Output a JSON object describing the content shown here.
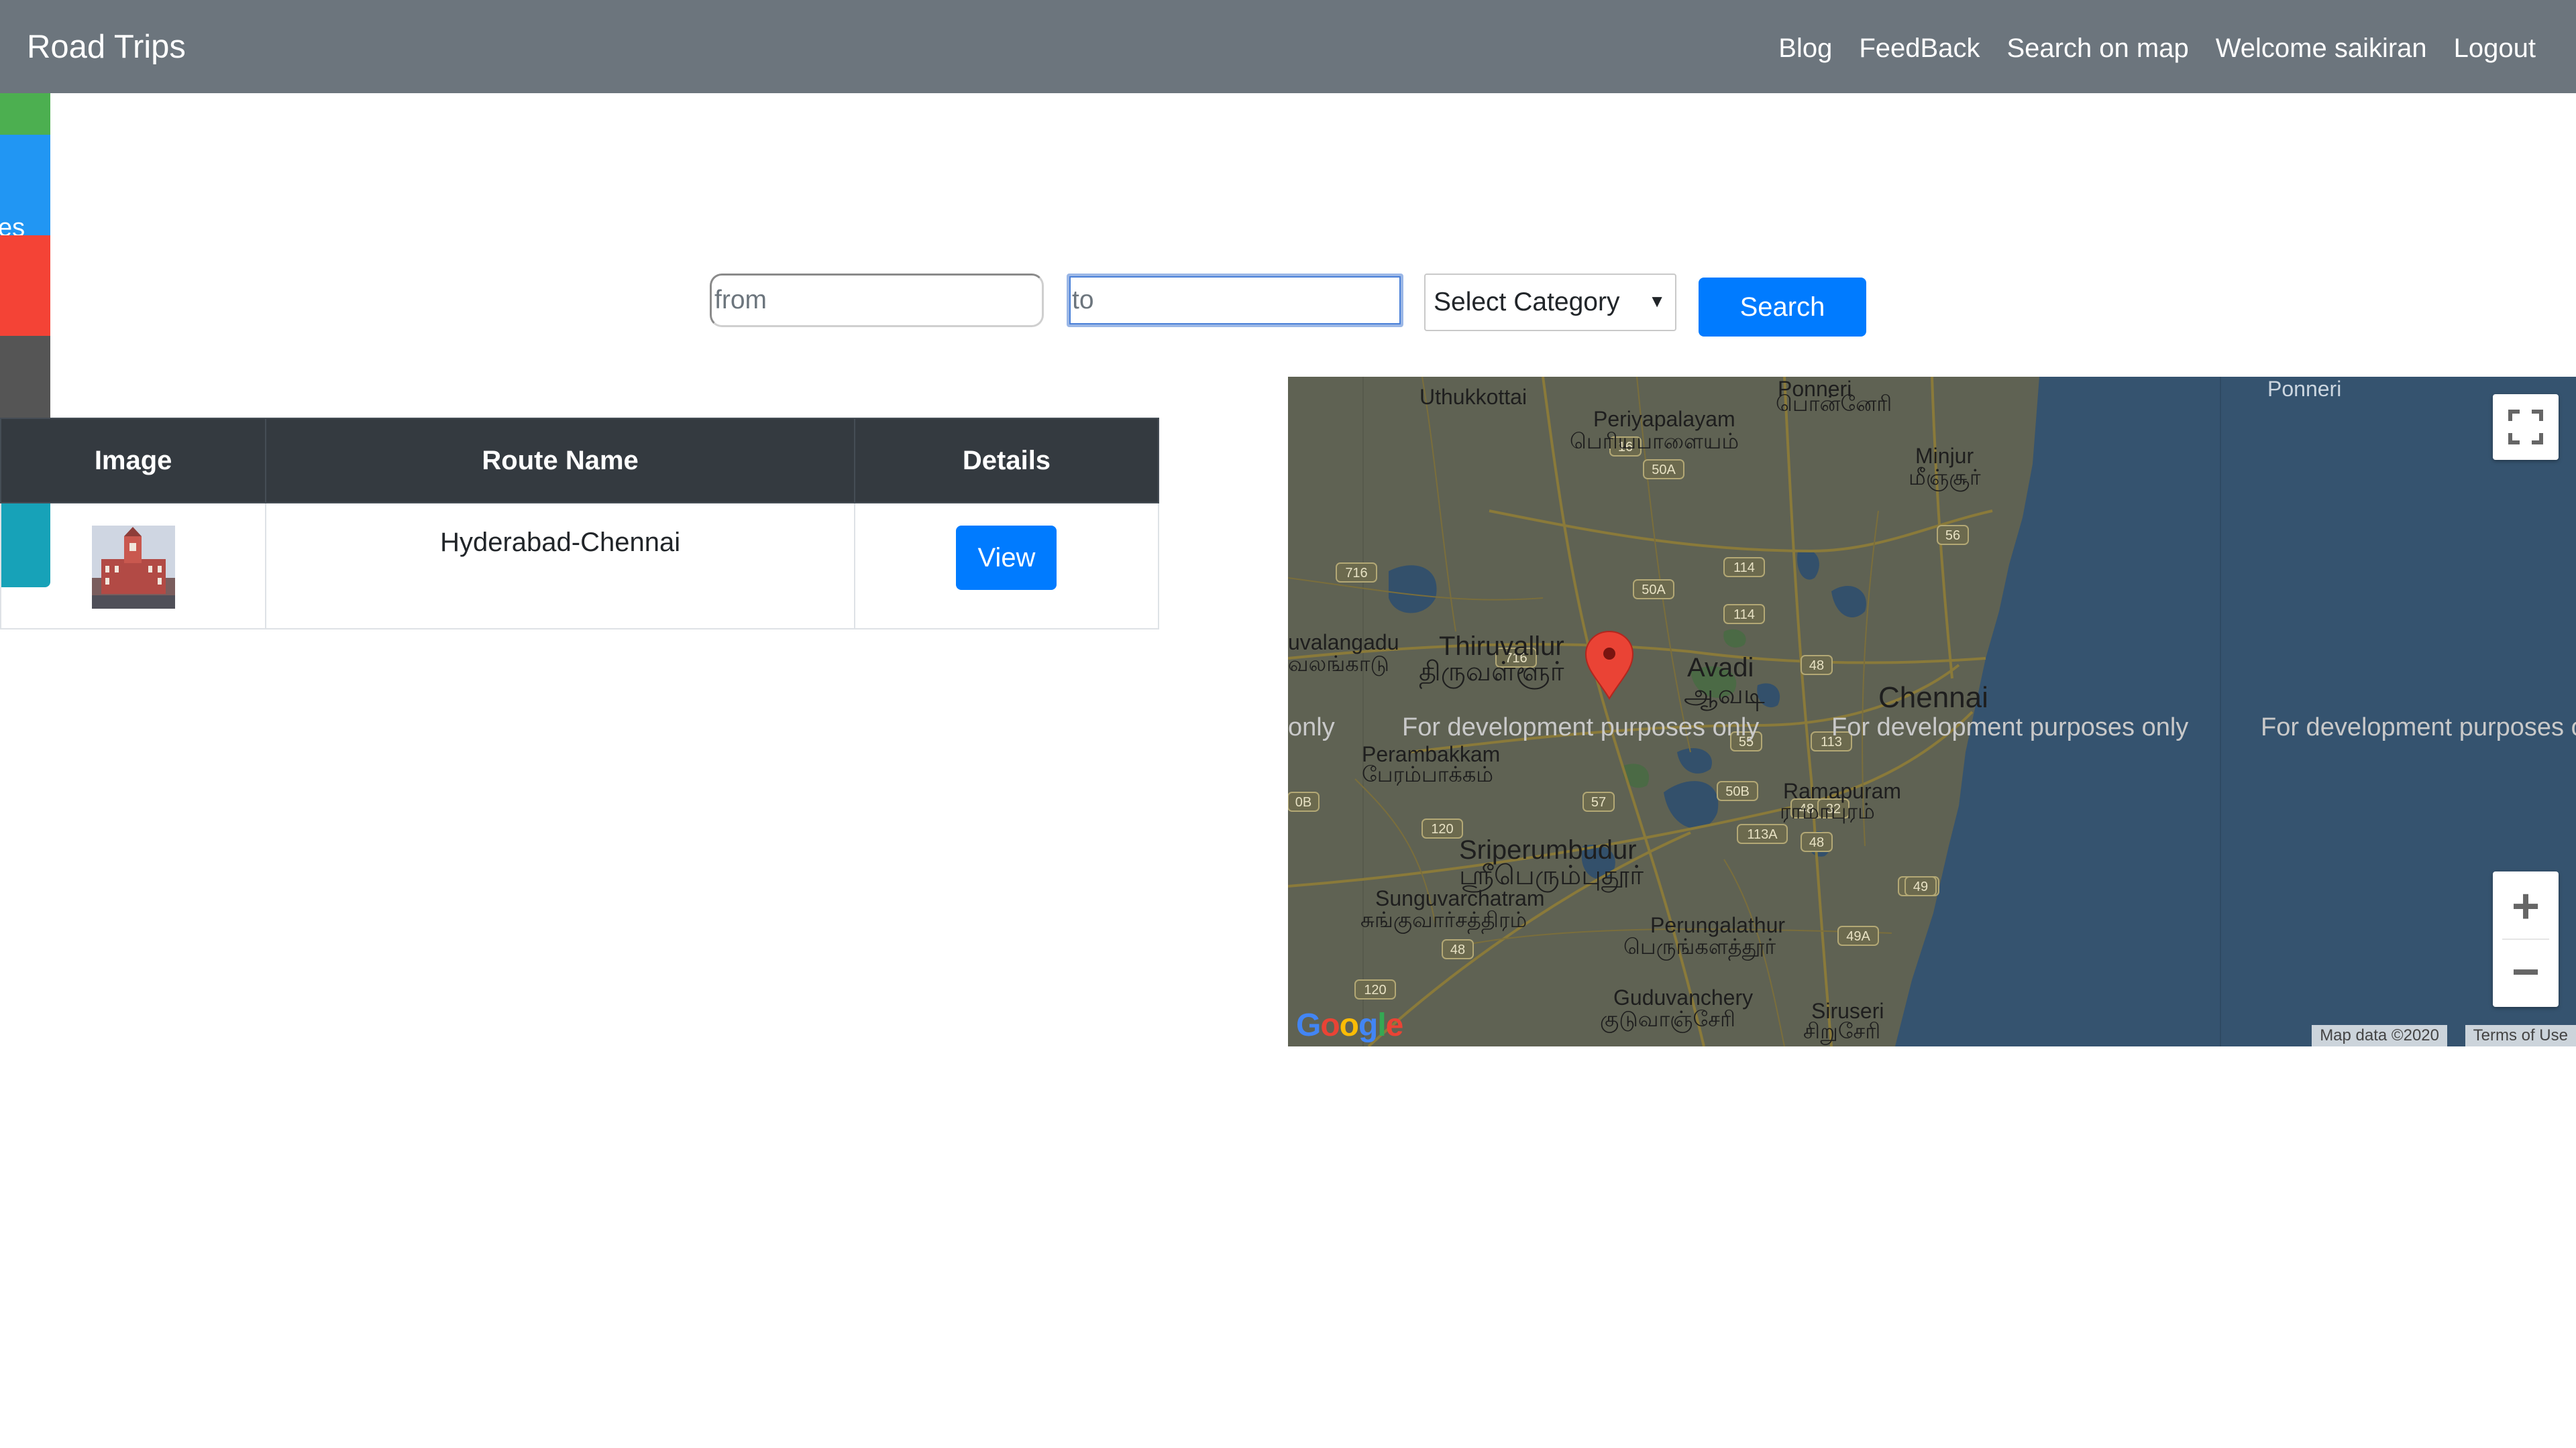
{
  "navbar": {
    "brand": "Road Trips",
    "links": [
      "Blog",
      "FeedBack",
      "Search on map",
      "Welcome saikiran",
      "Logout"
    ]
  },
  "side_tabs": [
    {
      "label": "",
      "color": "#4caf50"
    },
    {
      "label": "ites",
      "color": "#2196f3"
    },
    {
      "label": "",
      "color": "#f44336"
    },
    {
      "label": "",
      "color": "#555555"
    },
    {
      "label": "",
      "color": "#17a2b8"
    }
  ],
  "search": {
    "from_placeholder": "from",
    "from_value": "",
    "to_placeholder": "to",
    "to_value": "",
    "category_selected": "Select Category",
    "button_label": "Search"
  },
  "table": {
    "headers": [
      "Image",
      "Route Name",
      "Details"
    ],
    "rows": [
      {
        "image_icon": "building-thumbnail",
        "route_name": "Hyderabad-Chennai",
        "details_button": "View"
      }
    ]
  },
  "map": {
    "watermark": "For development purposes only",
    "watermark_left_fragment": "only",
    "watermark_right_fragment": "For development purposes o",
    "places": {
      "uthukkottai": "Uthukkottai",
      "periyapalayam_en": "Periyapalayam",
      "periyapalayam_ta": "பெரியபாளையம்",
      "ponneri_en": "Ponneri",
      "ponneri_ta": "பொன்னேரி",
      "ponneri_right": "Ponneri",
      "minjur_en": "Minjur",
      "minjur_ta": "மீஞ்சூர்",
      "thiruvallur_en": "Thiruvallur",
      "thiruvallur_ta": "திருவள்ளூர்",
      "avadi_en": "Avadi",
      "avadi_ta": "ஆவடி",
      "chennai": "Chennai",
      "uvalangadu_en": "uvalangadu",
      "uvalangadu_ta": "வலங்காடு",
      "perambakkam_en": "Perambakkam",
      "perambakkam_ta": "பேரம்பாக்கம்",
      "ramapuram_en": "Ramapuram",
      "ramapuram_ta": "ராமாபுரம்",
      "sriperumbudur_en": "Sriperumbudur",
      "sriperumbudur_ta": "ஸ்ரீபெரும்புதூர்",
      "sunguvarchatram_en": "Sunguvarchatram",
      "sunguvarchatram_ta": "சுங்குவார்சத்திரம்",
      "perungalathur_en": "Perungalathur",
      "perungalathur_ta": "பெருங்களத்தூர்",
      "guduvanchery_en": "Guduvanchery",
      "guduvanchery_ta": "குடுவாஞ்சேரி",
      "siruseri_en": "Siruseri",
      "siruseri_ta": "சிறுசேரி"
    },
    "road_shields": [
      "16",
      "50A",
      "56",
      "114",
      "716",
      "50A",
      "114",
      "48",
      "716",
      "55",
      "113",
      "57",
      "50B",
      "48",
      "32",
      "113A",
      "48",
      "109",
      "49",
      "49A",
      "120",
      "48",
      "120",
      "0B"
    ],
    "map_data": "Map data ©2020",
    "terms": "Terms of Use",
    "zoom_in": "+",
    "zoom_out": "−",
    "land_color": "#5f6253",
    "sea_color": "#35536f",
    "marker_color": "#ea4335"
  }
}
